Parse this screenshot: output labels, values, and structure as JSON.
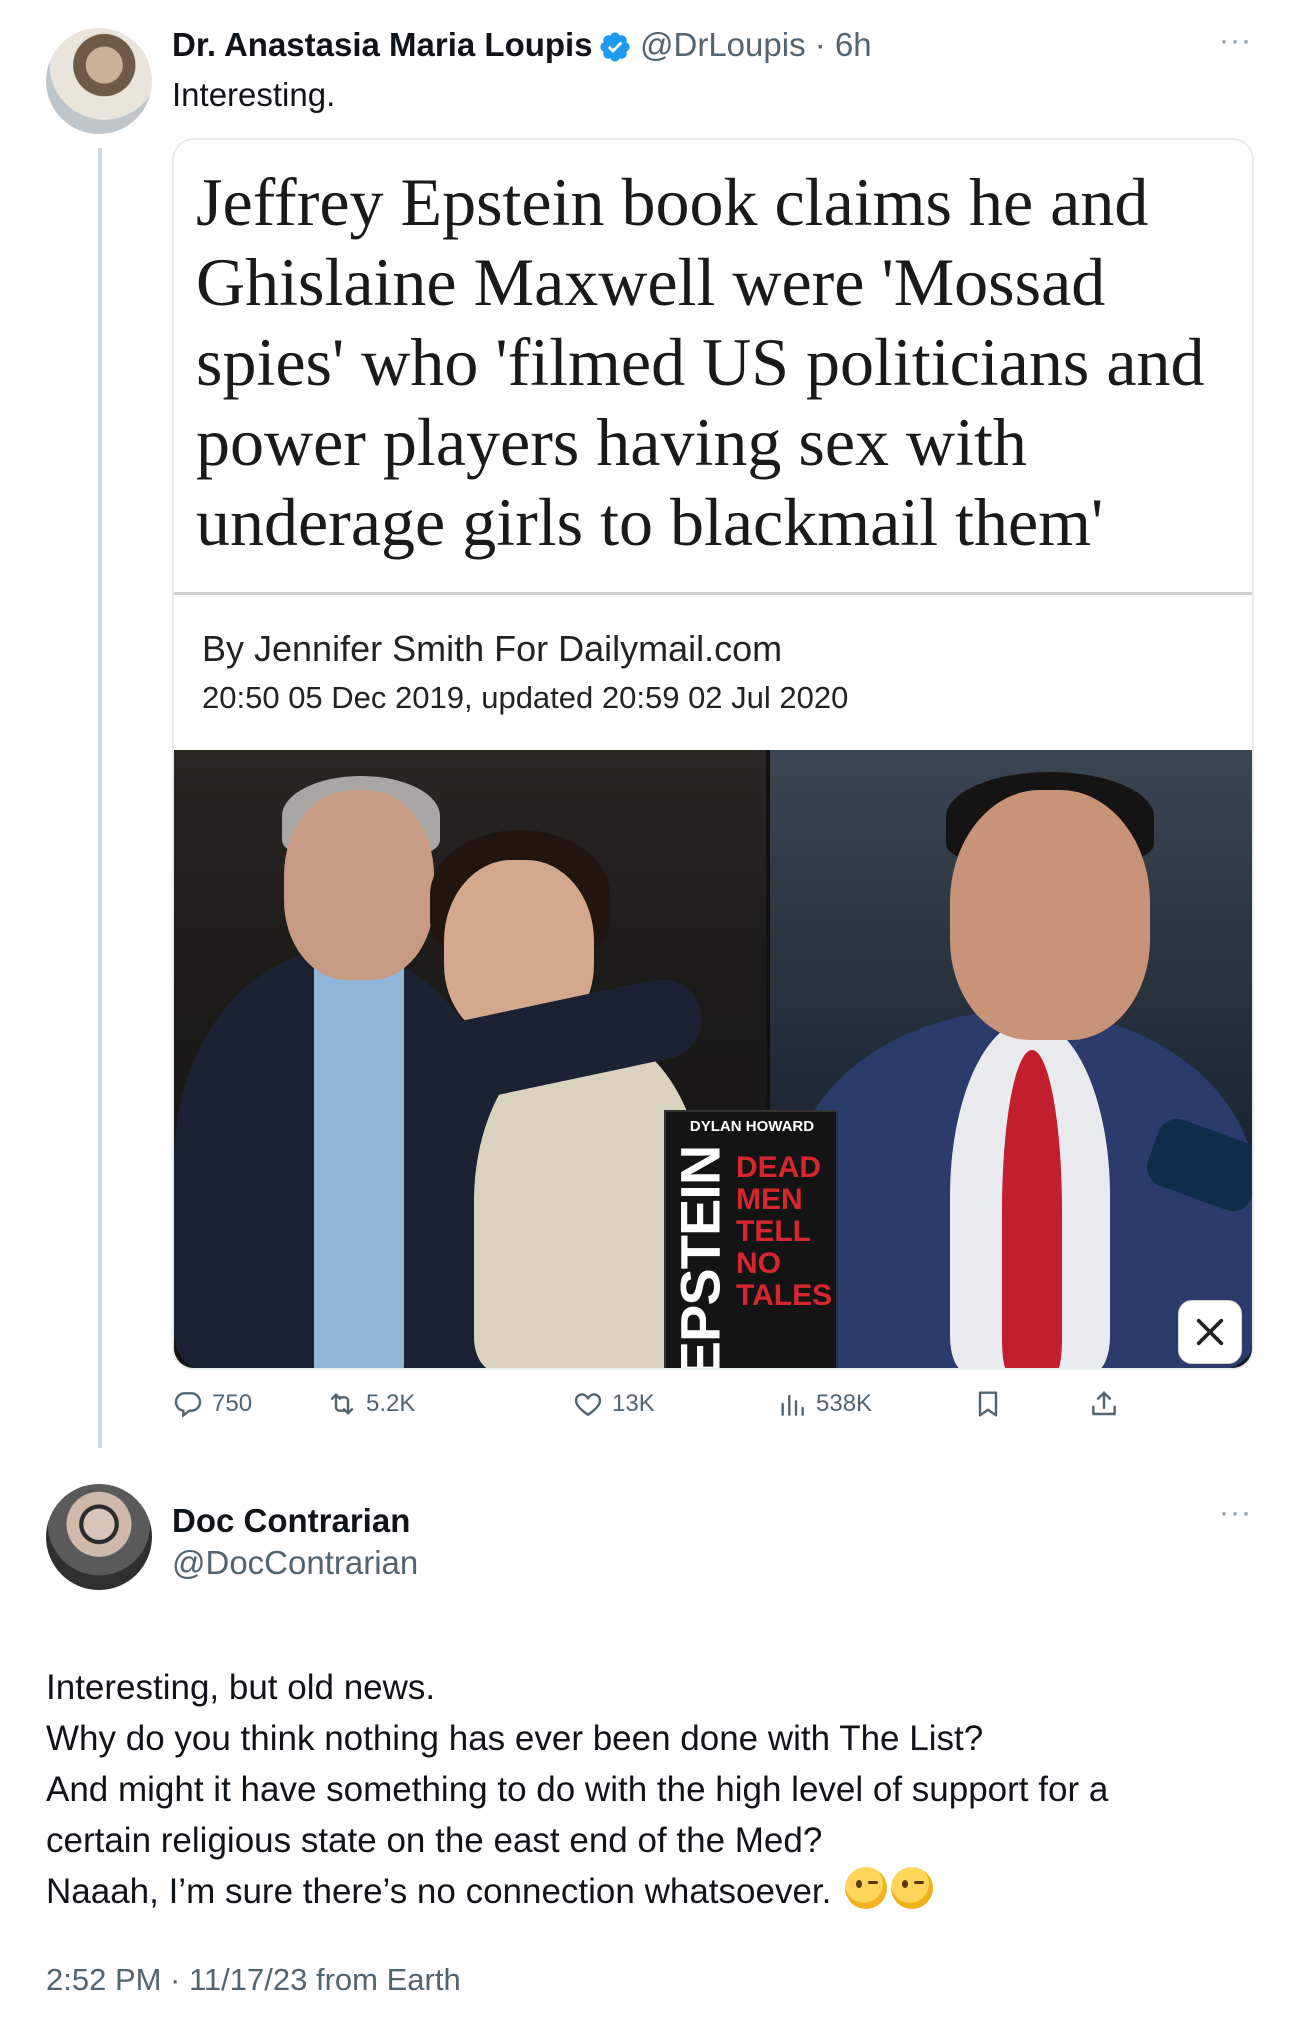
{
  "tweet": {
    "author_name": "Dr. Anastasia Maria Loupis",
    "handle_time": "@DrLoupis · 6h",
    "more": "···",
    "text": "Interesting.",
    "card": {
      "headline": "Jeffrey Epstein book claims he and Ghislaine Maxwell were 'Mossad spies' who 'filmed US politicians and power players having sex with underage girls to blackmail them'",
      "byline": "By Jennifer Smith For Dailymail.com",
      "dateline": "20:50 05 Dec 2019, updated 20:59 02 Jul 2020",
      "book": {
        "author": "DYLAN HOWARD",
        "spine": "EPSTEIN",
        "title_lines": [
          "DEAD",
          "MEN",
          "TELL",
          "NO",
          "TALES"
        ]
      }
    },
    "actions": {
      "replies": "750",
      "reposts": "5.2K",
      "likes": "13K",
      "views": "538K"
    }
  },
  "reply": {
    "author_name": "Doc Contrarian",
    "handle": "@DocContrarian",
    "more": "···",
    "lines": [
      "Interesting, but old news.",
      "Why do you think nothing has ever been done with The List?",
      "And might it have something to do with the high level of support for a",
      "certain religious state on the east end of the Med?",
      "Naaah, I’m sure there’s no connection whatsoever."
    ],
    "emoji": [
      "winking-face",
      "winking-face"
    ],
    "timestamp": "2:52 PM · 11/17/23 from Earth"
  },
  "colors": {
    "text": "#0f1419",
    "secondary": "#536471",
    "verified": "#1d9bf0",
    "border": "#e6ebee"
  }
}
